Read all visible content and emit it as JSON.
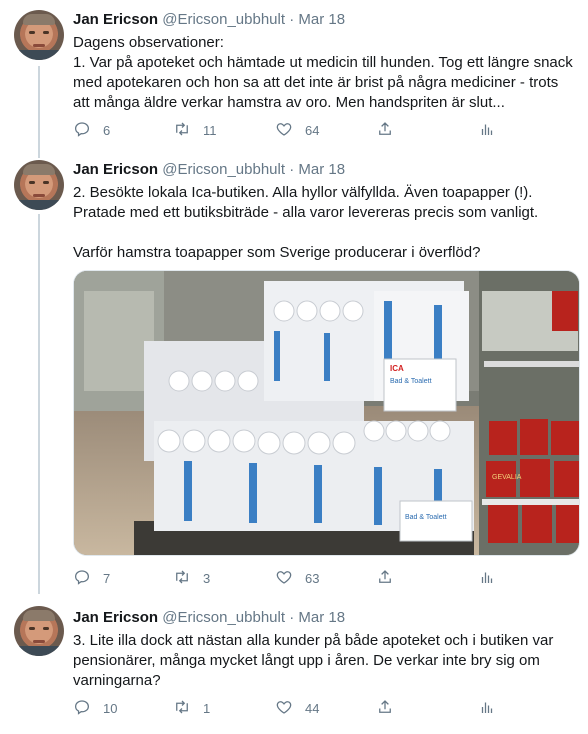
{
  "tweets": [
    {
      "author_name": "Jan Ericson",
      "handle": "@Ericson_ubbhult",
      "separator": "·",
      "date": "Mar 18",
      "lines": [
        "Dagens observationer:",
        "1. Var på apoteket och hämtade ut medicin till hunden. Tog ett längre snack med apotekaren och hon sa att det inte är brist på några mediciner - trots att många äldre verkar hamstra av oro. Men handspriten är slut..."
      ],
      "replies": "6",
      "retweets": "11",
      "likes": "64"
    },
    {
      "author_name": "Jan Ericson",
      "handle": "@Ericson_ubbhult",
      "separator": "·",
      "date": "Mar 18",
      "lines": [
        "2. Besökte lokala Ica-butiken. Alla hyllor välfyllda. Även toapapper (!). Pratade med ett butiksbiträde - alla varor levereras precis som vanligt.",
        "Varför hamstra toapapper som Sverige producerar i överflöd?"
      ],
      "photo_labels": [
        "ICA",
        "Bad & Toalett",
        "GEVALIA"
      ],
      "replies": "7",
      "retweets": "3",
      "likes": "63"
    },
    {
      "author_name": "Jan Ericson",
      "handle": "@Ericson_ubbhult",
      "separator": "·",
      "date": "Mar 18",
      "lines": [
        "3. Lite illa dock att nästan alla kunder på både apoteket och i butiken var pensionärer, många mycket långt upp i åren. De verkar inte bry sig om varningarna?"
      ],
      "replies": "10",
      "retweets": "1",
      "likes": "44"
    }
  ],
  "icons": [
    "reply-icon",
    "retweet-icon",
    "like-icon",
    "share-icon",
    "analytics-icon"
  ],
  "colors": {
    "text": "#14171a",
    "muted": "#657786",
    "thread_line": "#ccd6dd",
    "divider": "#e6ecf0"
  }
}
